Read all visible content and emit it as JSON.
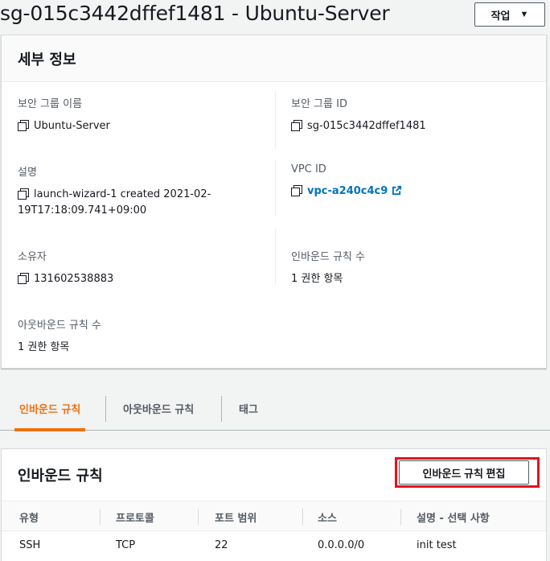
{
  "page": {
    "title": "sg-015c3442dffef1481 - Ubuntu-Server",
    "actions_label": "작업"
  },
  "details": {
    "heading": "세부 정보",
    "sg_name_label": "보안 그룹 이름",
    "sg_name_value": "Ubuntu-Server",
    "sg_id_label": "보안 그룹 ID",
    "sg_id_value": "sg-015c3442dffef1481",
    "description_label": "설명",
    "description_value_line1": "launch-wizard-1 created 2021-02-",
    "description_value_line2": "19T17:18:09.741+09:00",
    "vpc_id_label": "VPC ID",
    "vpc_id_value": "vpc-a240c4c9",
    "owner_label": "소유자",
    "owner_value": "131602538883",
    "inbound_count_label": "인바운드 규칙 수",
    "inbound_count_value": "1 권한 항목",
    "outbound_count_label": "아웃바운드 규칙 수",
    "outbound_count_value": "1 권한 항목"
  },
  "tabs": [
    {
      "label": "인바운드 규칙",
      "active": true
    },
    {
      "label": "아웃바운드 규칙",
      "active": false
    },
    {
      "label": "태그",
      "active": false
    }
  ],
  "inbound_rules": {
    "heading": "인바운드 규칙",
    "edit_button_label": "인바운드 규칙 편집",
    "columns": [
      "유형",
      "프로토콜",
      "포트 범위",
      "소스",
      "설명 - 선택 사항"
    ],
    "rows": [
      [
        "SSH",
        "TCP",
        "22",
        "0.0.0.0/0",
        "init test"
      ]
    ]
  },
  "colors": {
    "accent": "#ec7211",
    "link": "#0073bb",
    "highlight": "#e0141e"
  },
  "icons": [
    "copy-icon",
    "external-link-icon",
    "caret-down-icon"
  ]
}
